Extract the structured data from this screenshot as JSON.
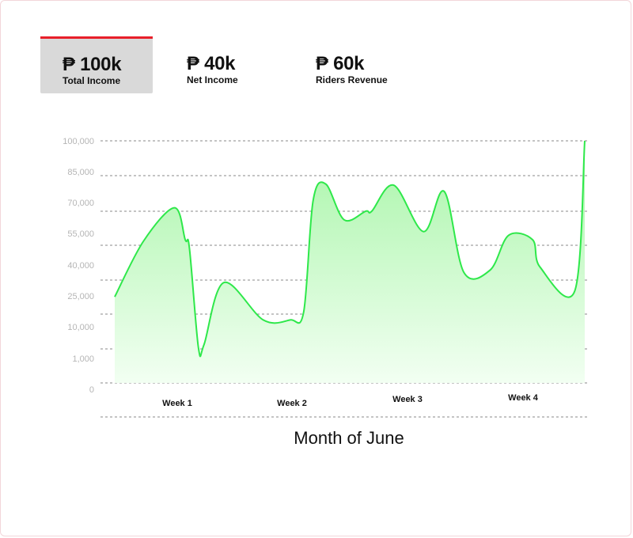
{
  "currency_symbol": "₱",
  "stats": [
    {
      "value": "₱ 100k",
      "label": "Total Income",
      "active": true
    },
    {
      "value": "₱ 40k",
      "label": "Net Income",
      "active": false
    },
    {
      "value": "₱ 60k",
      "label": "Riders Revenue",
      "active": false
    }
  ],
  "colors": {
    "accent": "#e8202a",
    "line": "#2ee84a",
    "fill_top": "#a8f5a8",
    "fill_bottom": "#f2fff2",
    "active_tab_bg": "#d9d9d9"
  },
  "chart_data": {
    "type": "area",
    "xlabel": "Month of June",
    "categories": [
      "Week 1",
      "Week 2",
      "Week 3",
      "Week 4"
    ],
    "y_tick_labels": [
      "0",
      "1,000",
      "10,000",
      "25,000",
      "40,000",
      "55,000",
      "70,000",
      "85,000",
      "100,000"
    ],
    "grid": true,
    "series": [
      {
        "y_level": [
          2.97,
          4.75,
          5.83,
          4.8,
          4.53,
          1.35,
          1.44,
          3.43,
          2.22,
          2.22,
          2.48,
          6.06,
          6.6,
          5.44,
          5.72,
          5.72,
          6.56,
          5.06,
          6.36,
          3.76,
          3.84,
          4.94,
          4.8,
          3.93,
          3.17,
          8.0
        ],
        "x_position": [
          0.0,
          0.061,
          0.127,
          0.15,
          0.159,
          0.178,
          0.19,
          0.232,
          0.316,
          0.373,
          0.402,
          0.422,
          0.449,
          0.488,
          0.534,
          0.547,
          0.594,
          0.657,
          0.701,
          0.743,
          0.799,
          0.838,
          0.889,
          0.905,
          0.979,
          1.0
        ]
      }
    ]
  }
}
